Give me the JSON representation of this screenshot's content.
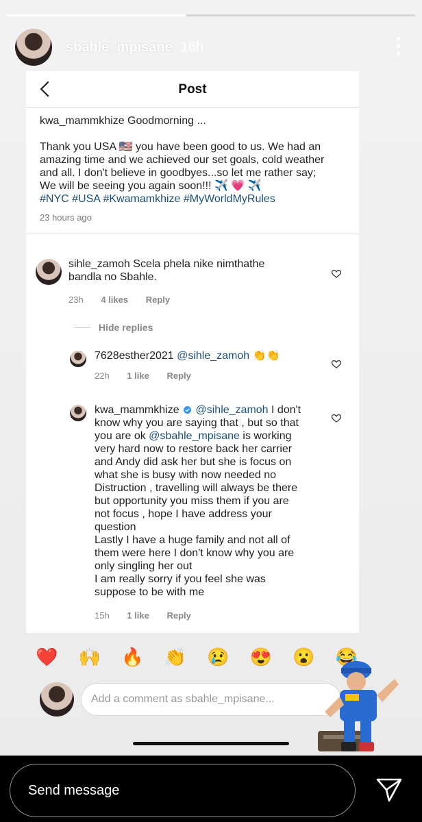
{
  "story": {
    "username": "sbahle_mpisane",
    "time": "16h",
    "progress": 0.44
  },
  "post": {
    "title": "Post",
    "caption_user": "kwa_mammkhize",
    "caption_greeting": "Goodmorning ...",
    "caption_lines": [
      "Thank you USA 🇺🇸 you have been good to us. We had an",
      "amazing time and we achieved our set goals, cold weather",
      "and all. I don't believe in goodbyes...so let me rather say;",
      "We will be seeing you again soon!!! ✈️ 💗 ✈️"
    ],
    "hashtags": "#NYC #USA #Kwamamkhize #MyWorldMyRules",
    "ago": "23 hours ago"
  },
  "comments": [
    {
      "user": "sihle_zamoh",
      "text": "Scela phela nike nimthathe bandla no Sbahle.",
      "time": "23h",
      "likes": "4 likes",
      "reply": "Reply"
    }
  ],
  "hide_replies": "Hide replies",
  "replies": [
    {
      "user": "7628esther2021",
      "mention": "@sihle_zamoh",
      "text": "👏👏",
      "time": "22h",
      "likes": "1 like",
      "reply": "Reply"
    },
    {
      "user": "kwa_mammkhize",
      "mention": "@sihle_zamoh",
      "lines": [
        "I don't",
        "know why you are saying that , but so that",
        "you are ok",
        "is working",
        "very hard now to restore back her carrier",
        "and Andy did ask her but she is focus on",
        "what she is busy with now needed no",
        "Distruction , travelling will always be there",
        "but opportunity you miss them if you are",
        "not focus , hope I have address your",
        "question",
        "Lastly I have a huge family and not all of",
        "them were here I don't know why you are",
        "only singling her out",
        "I am really sorry if you feel she was",
        "suppose to be with me"
      ],
      "mention2": "@sbahle_mpisane",
      "time": "15h",
      "likes": "1 like",
      "reply": "Reply"
    }
  ],
  "emojis": [
    "❤️",
    "🙌",
    "🔥",
    "👏",
    "😢",
    "😍",
    "😮",
    "😂"
  ],
  "compose_placeholder": "Add a comment as sbahle_mpisane...",
  "send_message": "Send message",
  "colors": {
    "mention": "#1c4f7a",
    "verified": "#3897f0"
  }
}
